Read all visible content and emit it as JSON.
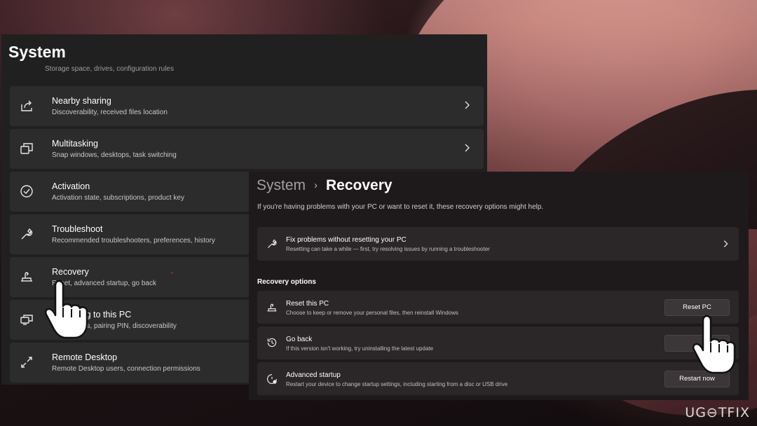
{
  "back_window": {
    "title": "System",
    "clipped_subtitle": "Storage space, drives, configuration rules",
    "items": [
      {
        "label": "Nearby sharing",
        "desc": "Discoverability, received files location",
        "icon": "share-icon"
      },
      {
        "label": "Multitasking",
        "desc": "Snap windows, desktops, task switching",
        "icon": "multitasking-icon"
      },
      {
        "label": "Activation",
        "desc": "Activation state, subscriptions, product key",
        "icon": "check-circle-icon"
      },
      {
        "label": "Troubleshoot",
        "desc": "Recommended troubleshooters, preferences, history",
        "icon": "wrench-icon"
      },
      {
        "label": "Recovery",
        "desc": "Reset, advanced startup, go back",
        "icon": "recovery-icon"
      },
      {
        "label": "Projecting to this PC",
        "desc": "Permissions, pairing PIN, discoverability",
        "icon": "projector-icon"
      },
      {
        "label": "Remote Desktop",
        "desc": "Remote Desktop users, connection permissions",
        "icon": "remote-desktop-icon"
      }
    ]
  },
  "front_window": {
    "breadcrumb_parent": "System",
    "breadcrumb_separator": "›",
    "breadcrumb_current": "Recovery",
    "intro": "If you're having problems with your PC or want to reset it, these recovery options might help.",
    "fix_card": {
      "label": "Fix problems without resetting your PC",
      "desc": "Resetting can take a while — first, try resolving issues by running a troubleshooter",
      "icon": "wrench-icon"
    },
    "section_label": "Recovery options",
    "options": [
      {
        "label": "Reset this PC",
        "desc": "Choose to keep or remove your personal files, then reinstall Windows",
        "button": "Reset PC",
        "icon": "reset-pc-icon"
      },
      {
        "label": "Go back",
        "desc": "If this version isn't working, try uninstalling the latest update",
        "button": "",
        "icon": "history-icon"
      },
      {
        "label": "Advanced startup",
        "desc": "Restart your device to change startup settings, including starting from a disc or USB drive",
        "button": "Restart now",
        "icon": "advanced-startup-icon"
      }
    ]
  },
  "watermark": "UG⊖TFIX",
  "colors": {
    "window_bg": "#202020",
    "card_bg": "#2c2c2c",
    "front_bg": "#1e1a1c",
    "text_primary": "#ffffff",
    "text_secondary": "#c8c8c8"
  }
}
